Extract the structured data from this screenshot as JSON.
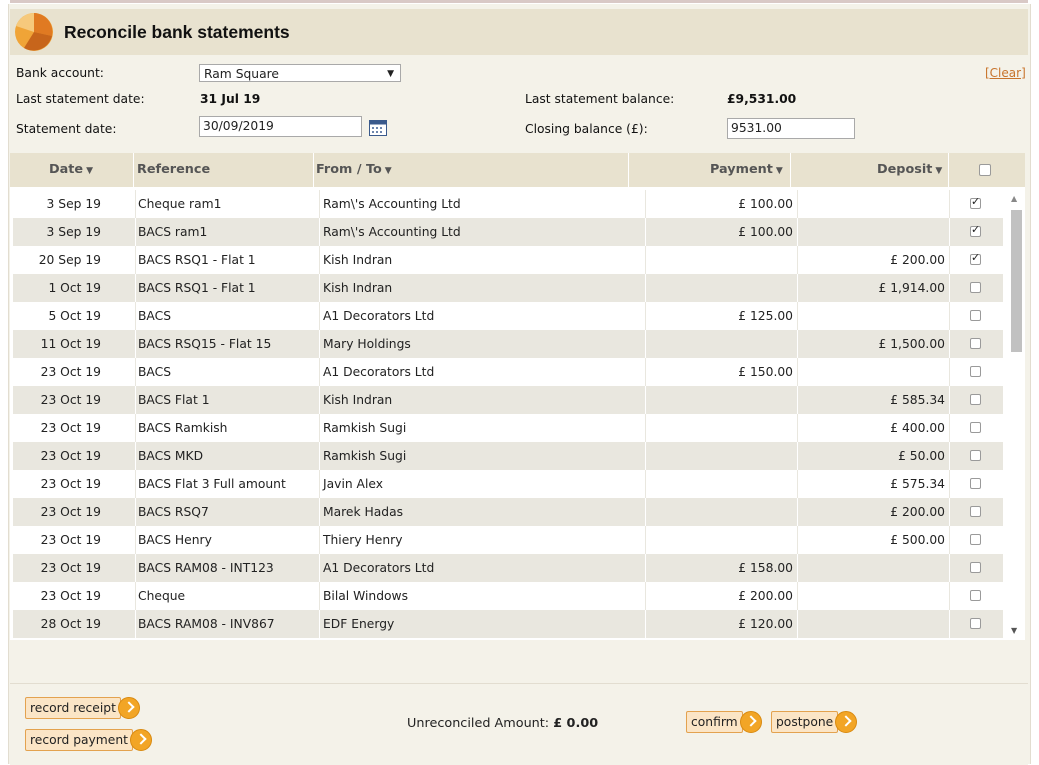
{
  "page": {
    "title": "Reconcile bank statements"
  },
  "form": {
    "bank_account_label": "Bank account:",
    "bank_account_value": "Ram Square",
    "last_statement_date_label": "Last statement date:",
    "last_statement_date_value": "31 Jul 19",
    "statement_date_label": "Statement date:",
    "statement_date_value": "30/09/2019",
    "last_statement_balance_label": "Last statement balance:",
    "last_statement_balance_value": "£9,531.00",
    "closing_balance_label": "Closing balance (£):",
    "closing_balance_value": "9531.00",
    "clear_link": "[Clear]"
  },
  "table": {
    "columns": {
      "date": "Date",
      "reference": "Reference",
      "from_to": "From / To",
      "payment": "Payment",
      "deposit": "Deposit"
    },
    "rows": [
      {
        "date": "3 Sep 19",
        "reference": "Cheque ram1",
        "from_to": "Ram\\'s Accounting Ltd",
        "payment": "£ 100.00",
        "deposit": "",
        "checked": true
      },
      {
        "date": "3 Sep 19",
        "reference": "BACS ram1",
        "from_to": "Ram\\'s Accounting Ltd",
        "payment": "£ 100.00",
        "deposit": "",
        "checked": true
      },
      {
        "date": "20 Sep 19",
        "reference": "BACS RSQ1 - Flat 1",
        "from_to": "Kish Indran",
        "payment": "",
        "deposit": "£ 200.00",
        "checked": true
      },
      {
        "date": "1 Oct 19",
        "reference": "BACS RSQ1 - Flat 1",
        "from_to": "Kish Indran",
        "payment": "",
        "deposit": "£ 1,914.00",
        "checked": false
      },
      {
        "date": "5 Oct 19",
        "reference": "BACS",
        "from_to": "A1 Decorators Ltd",
        "payment": "£ 125.00",
        "deposit": "",
        "checked": false
      },
      {
        "date": "11 Oct 19",
        "reference": "BACS RSQ15 - Flat 15",
        "from_to": "Mary Holdings",
        "payment": "",
        "deposit": "£ 1,500.00",
        "checked": false
      },
      {
        "date": "23 Oct 19",
        "reference": "BACS",
        "from_to": "A1 Decorators Ltd",
        "payment": "£ 150.00",
        "deposit": "",
        "checked": false
      },
      {
        "date": "23 Oct 19",
        "reference": "BACS Flat 1",
        "from_to": "Kish Indran",
        "payment": "",
        "deposit": "£ 585.34",
        "checked": false
      },
      {
        "date": "23 Oct 19",
        "reference": "BACS Ramkish",
        "from_to": "Ramkish Sugi",
        "payment": "",
        "deposit": "£ 400.00",
        "checked": false
      },
      {
        "date": "23 Oct 19",
        "reference": "BACS MKD",
        "from_to": "Ramkish Sugi",
        "payment": "",
        "deposit": "£ 50.00",
        "checked": false
      },
      {
        "date": "23 Oct 19",
        "reference": "BACS Flat 3 Full amount",
        "from_to": "Javin Alex",
        "payment": "",
        "deposit": "£ 575.34",
        "checked": false
      },
      {
        "date": "23 Oct 19",
        "reference": "BACS RSQ7",
        "from_to": "Marek Hadas",
        "payment": "",
        "deposit": "£ 200.00",
        "checked": false
      },
      {
        "date": "23 Oct 19",
        "reference": "BACS Henry",
        "from_to": "Thiery Henry",
        "payment": "",
        "deposit": "£ 500.00",
        "checked": false
      },
      {
        "date": "23 Oct 19",
        "reference": "BACS RAM08 - INT123",
        "from_to": "A1 Decorators Ltd",
        "payment": "£ 158.00",
        "deposit": "",
        "checked": false
      },
      {
        "date": "23 Oct 19",
        "reference": "Cheque",
        "from_to": "Bilal Windows",
        "payment": "£ 200.00",
        "deposit": "",
        "checked": false
      },
      {
        "date": "28 Oct 19",
        "reference": "BACS RAM08 - INV867",
        "from_to": "EDF Energy",
        "payment": "£ 120.00",
        "deposit": "",
        "checked": false
      }
    ]
  },
  "footer": {
    "record_receipt": "record receipt",
    "record_payment": "record payment",
    "unreconciled_label": "Unreconciled Amount:",
    "unreconciled_value": "£ 0.00",
    "confirm": "confirm",
    "postpone": "postpone"
  },
  "colors": {
    "header_bg": "#e8e2cf",
    "panel_bg": "#f4f2e9",
    "row_alt": "#e9e7df",
    "button_bg": "#fbe5c6",
    "button_border": "#e3a24f",
    "go_orange": "#f2a526",
    "link": "#c8742c"
  },
  "icons": {
    "logo": "pie-chart-logo-icon",
    "calendar": "calendar-icon",
    "sort": "caret-down-icon",
    "go": "chevron-right-icon"
  }
}
